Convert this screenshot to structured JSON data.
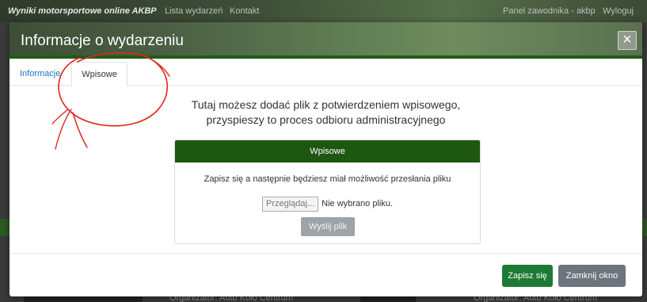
{
  "background": {
    "nav": {
      "brand": "Wyniki motorsportowe online AKBP",
      "events_link": "Lista wydarzeń",
      "contact_link": "Kontakt",
      "panel_link": "Panel zawodnika - akbp",
      "logout_link": "Wyloguj"
    },
    "footer_left": "Organizator: Auto Koło Centrum",
    "footer_right": "Organizator: Auto Koło Centrum"
  },
  "modal": {
    "title": "Informacje o wydarzeniu",
    "close_glyph": "×",
    "tabs": [
      {
        "label": "Informacje",
        "active": false
      },
      {
        "label": "Wpisowe",
        "active": true
      }
    ],
    "intro_line1": "Tutaj możesz dodać plik z potwierdzeniem wpisowego,",
    "intro_line2": "przyspieszy to proces odbioru administracyjnego",
    "card": {
      "header": "Wpisowe",
      "text": "Zapisz się a następnie będziesz miał możliwość przesłania pliku",
      "browse_label": "Przeglądaj...",
      "file_status": "Nie wybrano pliku.",
      "send_label": "Wyślij plik"
    },
    "footer": {
      "save_label": "Zapisz się",
      "close_label": "Zamknij okno"
    }
  },
  "colors": {
    "header_accent": "#1f5a14",
    "card_header": "#1d5712",
    "save_button": "#1d7a34",
    "close_button": "#6c757d",
    "annotation": "#e0261b",
    "tab_link": "#1a73c8"
  }
}
